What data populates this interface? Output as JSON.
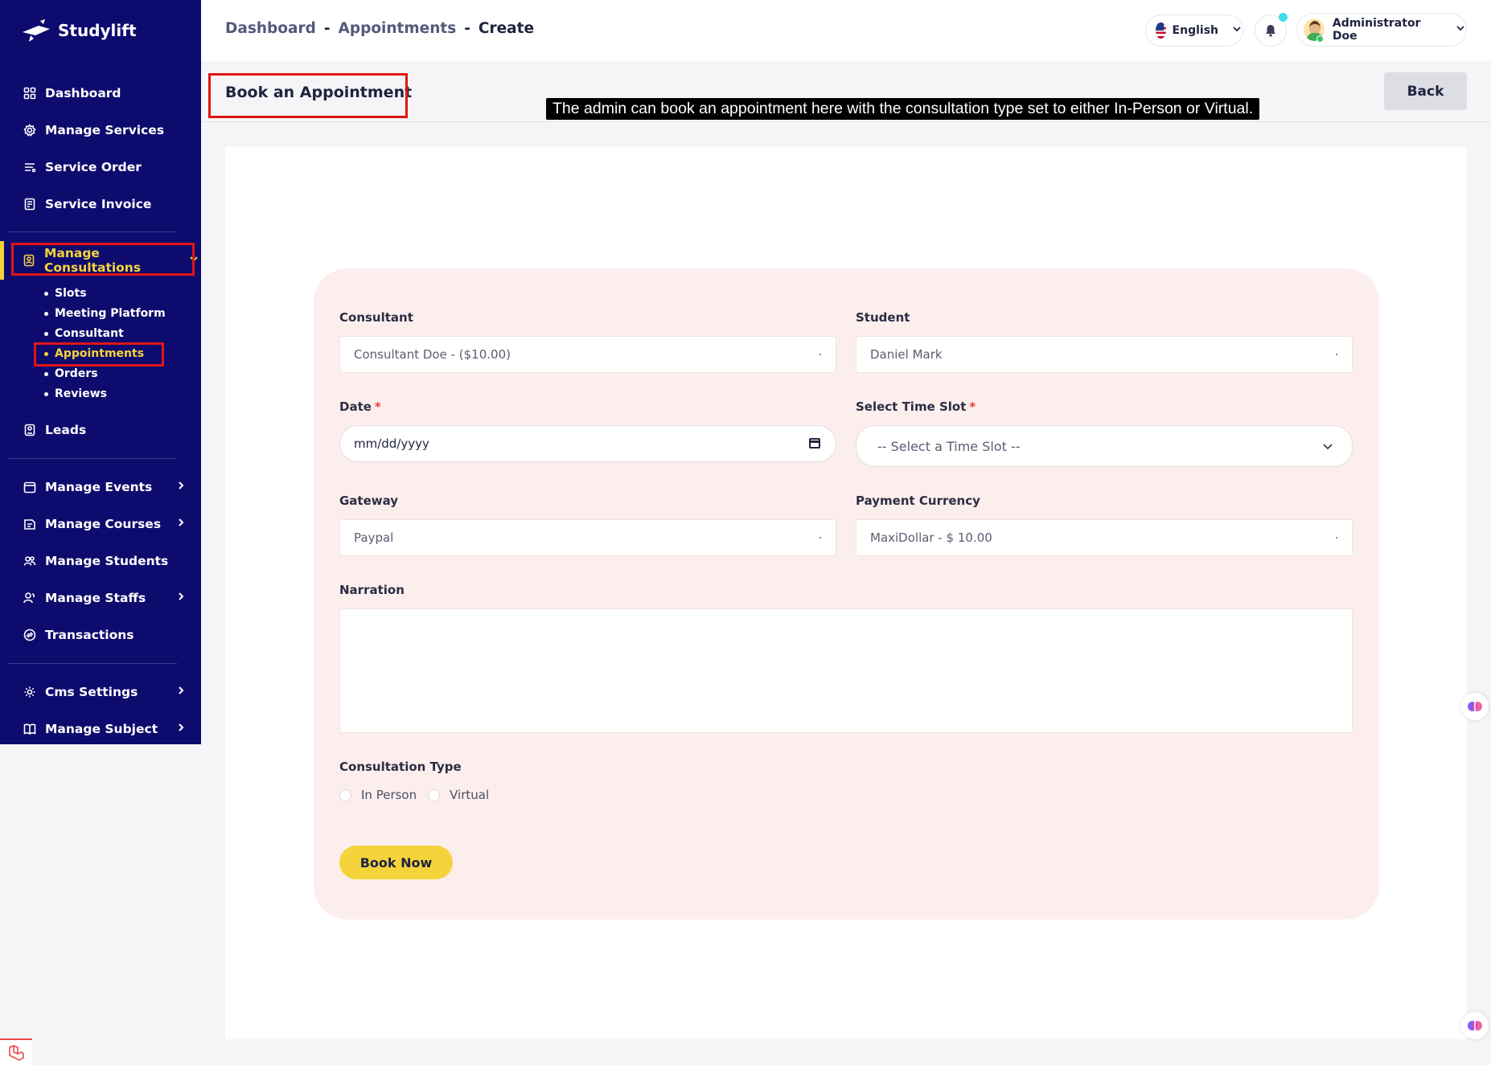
{
  "brand": {
    "name": "Studylift"
  },
  "sidebar": {
    "items": [
      {
        "label": "Dashboard",
        "icon": "grid-icon"
      },
      {
        "label": "Manage Services",
        "icon": "gear-icon"
      },
      {
        "label": "Service Order",
        "icon": "list-icon"
      },
      {
        "label": "Service Invoice",
        "icon": "invoice-icon"
      },
      {
        "label": "Manage Consultations",
        "icon": "consult-icon"
      },
      {
        "label": "Leads",
        "icon": "lead-icon"
      },
      {
        "label": "Manage Events",
        "icon": "calendar-icon"
      },
      {
        "label": "Manage Courses",
        "icon": "course-icon"
      },
      {
        "label": "Manage Students",
        "icon": "students-icon"
      },
      {
        "label": "Manage Staffs",
        "icon": "staff-icon"
      },
      {
        "label": "Transactions",
        "icon": "transaction-icon"
      },
      {
        "label": "Cms Settings",
        "icon": "settings-icon"
      },
      {
        "label": "Manage Subject",
        "icon": "book-icon"
      }
    ],
    "consultation_subitems": [
      {
        "label": "Slots"
      },
      {
        "label": "Meeting Platform"
      },
      {
        "label": "Consultant"
      },
      {
        "label": "Appointments"
      },
      {
        "label": "Orders"
      },
      {
        "label": "Reviews"
      }
    ],
    "active_color": "#f5d33a",
    "bg_color": "#0e0b6e"
  },
  "header": {
    "breadcrumb": {
      "first": "Dashboard",
      "sep": "-",
      "second": "Appointments",
      "current": "Create"
    },
    "language": "English",
    "user": "Administrator Doe"
  },
  "page": {
    "title": "Book an Appointment",
    "back_label": "Back",
    "tooltip": "The admin can book an appointment here with the consultation type set to either In-Person or Virtual."
  },
  "form": {
    "consultant": {
      "label": "Consultant",
      "value": "Consultant Doe - ($10.00)"
    },
    "student": {
      "label": "Student",
      "value": "Daniel Mark"
    },
    "date": {
      "label": "Date",
      "required": "*",
      "placeholder": "mm/dd/yyyy"
    },
    "time_slot": {
      "label": "Select Time Slot",
      "required": "*",
      "value": "-- Select a Time Slot --"
    },
    "gateway": {
      "label": "Gateway",
      "value": "Paypal"
    },
    "payment_currency": {
      "label": "Payment Currency",
      "value": "MaxiDollar - $ 10.00"
    },
    "narration": {
      "label": "Narration",
      "value": ""
    },
    "consultation_type": {
      "label": "Consultation Type",
      "options": [
        "In Person",
        "Virtual"
      ]
    },
    "submit_label": "Book Now"
  }
}
